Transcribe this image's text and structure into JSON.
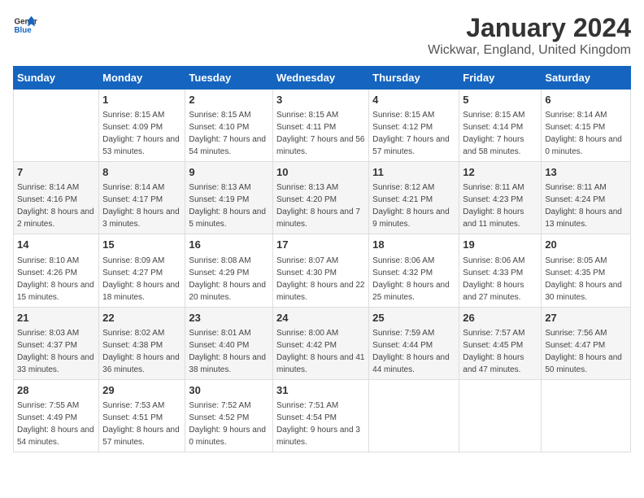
{
  "header": {
    "logo_general": "General",
    "logo_blue": "Blue",
    "title": "January 2024",
    "subtitle": "Wickwar, England, United Kingdom"
  },
  "days_of_week": [
    "Sunday",
    "Monday",
    "Tuesday",
    "Wednesday",
    "Thursday",
    "Friday",
    "Saturday"
  ],
  "weeks": [
    {
      "days": [
        {
          "num": "",
          "empty": true
        },
        {
          "num": "1",
          "sunrise": "Sunrise: 8:15 AM",
          "sunset": "Sunset: 4:09 PM",
          "daylight": "Daylight: 7 hours and 53 minutes."
        },
        {
          "num": "2",
          "sunrise": "Sunrise: 8:15 AM",
          "sunset": "Sunset: 4:10 PM",
          "daylight": "Daylight: 7 hours and 54 minutes."
        },
        {
          "num": "3",
          "sunrise": "Sunrise: 8:15 AM",
          "sunset": "Sunset: 4:11 PM",
          "daylight": "Daylight: 7 hours and 56 minutes."
        },
        {
          "num": "4",
          "sunrise": "Sunrise: 8:15 AM",
          "sunset": "Sunset: 4:12 PM",
          "daylight": "Daylight: 7 hours and 57 minutes."
        },
        {
          "num": "5",
          "sunrise": "Sunrise: 8:15 AM",
          "sunset": "Sunset: 4:14 PM",
          "daylight": "Daylight: 7 hours and 58 minutes."
        },
        {
          "num": "6",
          "sunrise": "Sunrise: 8:14 AM",
          "sunset": "Sunset: 4:15 PM",
          "daylight": "Daylight: 8 hours and 0 minutes."
        }
      ]
    },
    {
      "days": [
        {
          "num": "7",
          "sunrise": "Sunrise: 8:14 AM",
          "sunset": "Sunset: 4:16 PM",
          "daylight": "Daylight: 8 hours and 2 minutes."
        },
        {
          "num": "8",
          "sunrise": "Sunrise: 8:14 AM",
          "sunset": "Sunset: 4:17 PM",
          "daylight": "Daylight: 8 hours and 3 minutes."
        },
        {
          "num": "9",
          "sunrise": "Sunrise: 8:13 AM",
          "sunset": "Sunset: 4:19 PM",
          "daylight": "Daylight: 8 hours and 5 minutes."
        },
        {
          "num": "10",
          "sunrise": "Sunrise: 8:13 AM",
          "sunset": "Sunset: 4:20 PM",
          "daylight": "Daylight: 8 hours and 7 minutes."
        },
        {
          "num": "11",
          "sunrise": "Sunrise: 8:12 AM",
          "sunset": "Sunset: 4:21 PM",
          "daylight": "Daylight: 8 hours and 9 minutes."
        },
        {
          "num": "12",
          "sunrise": "Sunrise: 8:11 AM",
          "sunset": "Sunset: 4:23 PM",
          "daylight": "Daylight: 8 hours and 11 minutes."
        },
        {
          "num": "13",
          "sunrise": "Sunrise: 8:11 AM",
          "sunset": "Sunset: 4:24 PM",
          "daylight": "Daylight: 8 hours and 13 minutes."
        }
      ]
    },
    {
      "days": [
        {
          "num": "14",
          "sunrise": "Sunrise: 8:10 AM",
          "sunset": "Sunset: 4:26 PM",
          "daylight": "Daylight: 8 hours and 15 minutes."
        },
        {
          "num": "15",
          "sunrise": "Sunrise: 8:09 AM",
          "sunset": "Sunset: 4:27 PM",
          "daylight": "Daylight: 8 hours and 18 minutes."
        },
        {
          "num": "16",
          "sunrise": "Sunrise: 8:08 AM",
          "sunset": "Sunset: 4:29 PM",
          "daylight": "Daylight: 8 hours and 20 minutes."
        },
        {
          "num": "17",
          "sunrise": "Sunrise: 8:07 AM",
          "sunset": "Sunset: 4:30 PM",
          "daylight": "Daylight: 8 hours and 22 minutes."
        },
        {
          "num": "18",
          "sunrise": "Sunrise: 8:06 AM",
          "sunset": "Sunset: 4:32 PM",
          "daylight": "Daylight: 8 hours and 25 minutes."
        },
        {
          "num": "19",
          "sunrise": "Sunrise: 8:06 AM",
          "sunset": "Sunset: 4:33 PM",
          "daylight": "Daylight: 8 hours and 27 minutes."
        },
        {
          "num": "20",
          "sunrise": "Sunrise: 8:05 AM",
          "sunset": "Sunset: 4:35 PM",
          "daylight": "Daylight: 8 hours and 30 minutes."
        }
      ]
    },
    {
      "days": [
        {
          "num": "21",
          "sunrise": "Sunrise: 8:03 AM",
          "sunset": "Sunset: 4:37 PM",
          "daylight": "Daylight: 8 hours and 33 minutes."
        },
        {
          "num": "22",
          "sunrise": "Sunrise: 8:02 AM",
          "sunset": "Sunset: 4:38 PM",
          "daylight": "Daylight: 8 hours and 36 minutes."
        },
        {
          "num": "23",
          "sunrise": "Sunrise: 8:01 AM",
          "sunset": "Sunset: 4:40 PM",
          "daylight": "Daylight: 8 hours and 38 minutes."
        },
        {
          "num": "24",
          "sunrise": "Sunrise: 8:00 AM",
          "sunset": "Sunset: 4:42 PM",
          "daylight": "Daylight: 8 hours and 41 minutes."
        },
        {
          "num": "25",
          "sunrise": "Sunrise: 7:59 AM",
          "sunset": "Sunset: 4:44 PM",
          "daylight": "Daylight: 8 hours and 44 minutes."
        },
        {
          "num": "26",
          "sunrise": "Sunrise: 7:57 AM",
          "sunset": "Sunset: 4:45 PM",
          "daylight": "Daylight: 8 hours and 47 minutes."
        },
        {
          "num": "27",
          "sunrise": "Sunrise: 7:56 AM",
          "sunset": "Sunset: 4:47 PM",
          "daylight": "Daylight: 8 hours and 50 minutes."
        }
      ]
    },
    {
      "days": [
        {
          "num": "28",
          "sunrise": "Sunrise: 7:55 AM",
          "sunset": "Sunset: 4:49 PM",
          "daylight": "Daylight: 8 hours and 54 minutes."
        },
        {
          "num": "29",
          "sunrise": "Sunrise: 7:53 AM",
          "sunset": "Sunset: 4:51 PM",
          "daylight": "Daylight: 8 hours and 57 minutes."
        },
        {
          "num": "30",
          "sunrise": "Sunrise: 7:52 AM",
          "sunset": "Sunset: 4:52 PM",
          "daylight": "Daylight: 9 hours and 0 minutes."
        },
        {
          "num": "31",
          "sunrise": "Sunrise: 7:51 AM",
          "sunset": "Sunset: 4:54 PM",
          "daylight": "Daylight: 9 hours and 3 minutes."
        },
        {
          "num": "",
          "empty": true
        },
        {
          "num": "",
          "empty": true
        },
        {
          "num": "",
          "empty": true
        }
      ]
    }
  ]
}
